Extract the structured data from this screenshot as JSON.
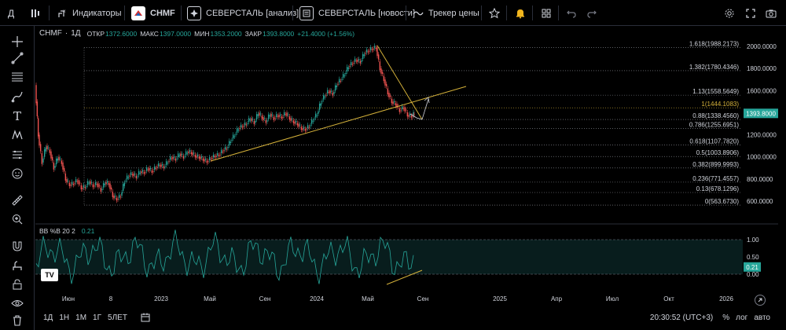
{
  "topbar": {
    "logo_letter": "Д",
    "indicators_label": "Индикаторы",
    "symbol": "CHMF",
    "tab_analysis": "СЕВЕРСТАЛЬ [анализ]",
    "tab_news": "СЕВЕРСТАЛЬ [новости]",
    "tracker_label": "Трекер цены",
    "icons": [
      "sidebar-icon",
      "indicators-icon",
      "brand-logo-icon",
      "tab-icon",
      "news-icon",
      "wave-icon",
      "star-icon",
      "alert-bell-icon",
      "grid-icon",
      "undo-icon",
      "redo-icon",
      "settings-icon",
      "fullscreen-icon",
      "camera-icon"
    ]
  },
  "legend": {
    "symbol": "CHMF",
    "interval": "1Д",
    "open_label": "ОТКР",
    "open": "1372.6000",
    "high_label": "МАКС",
    "high": "1397.0000",
    "low_label": "МИН",
    "low": "1353.2000",
    "close_label": "ЗАКР",
    "close": "1393.8000",
    "change": "+21.4000 (+1.56%)"
  },
  "fib_levels": [
    {
      "label": "1.618(1988.2173)",
      "value": 1988.2173
    },
    {
      "label": "1.382(1780.4346)",
      "value": 1780.4346
    },
    {
      "label": "1.13(1558.5649)",
      "value": 1558.5649
    },
    {
      "label": "1(1444.1083)",
      "value": 1444.1083
    },
    {
      "label": "0.88(1338.4560)",
      "value": 1338.456
    },
    {
      "label": "0.786(1255.6951)",
      "value": 1255.6951
    },
    {
      "label": "0.618(1107.7820)",
      "value": 1107.782
    },
    {
      "label": "0.5(1003.8906)",
      "value": 1003.8906
    },
    {
      "label": "0.382(899.9993)",
      "value": 899.9993
    },
    {
      "label": "0.236(771.4557)",
      "value": 771.4557
    },
    {
      "label": "0.13(678.1296)",
      "value": 678.1296
    },
    {
      "label": "0(563.6730)",
      "value": 563.673
    }
  ],
  "price_axis": {
    "ticks": [
      "2000.0000",
      "1800.0000",
      "1600.0000",
      "1400.0000",
      "1200.0000",
      "1000.0000",
      "800.0000",
      "600.0000"
    ],
    "current_price": "1393.8000"
  },
  "bb_indicator": {
    "label": "BB %B 20 2",
    "value": "0.21",
    "ticks": [
      "1.00",
      "0.50",
      "0.00"
    ],
    "current": "0.21"
  },
  "time_axis": [
    "Июн",
    "8",
    "2023",
    "Май",
    "Сен",
    "2024",
    "Май",
    "Сен",
    "2025",
    "Апр",
    "Июл",
    "Окт",
    "2026"
  ],
  "bottombar": {
    "ranges": [
      "1Д",
      "1Н",
      "1М",
      "1Г",
      "5ЛЕТ"
    ],
    "time": "20:30:52 (UTC+3)",
    "percent": "%",
    "log": "лог",
    "auto": "авто"
  },
  "tv_logo": "TV",
  "colors": {
    "background": "#000000",
    "up": "#26a69a",
    "down": "#ef5350",
    "trend": "#d4b13a",
    "current_price_bg": "#26a69a",
    "bb_line": "#26a69a",
    "fib_line": "#9598a1"
  }
}
